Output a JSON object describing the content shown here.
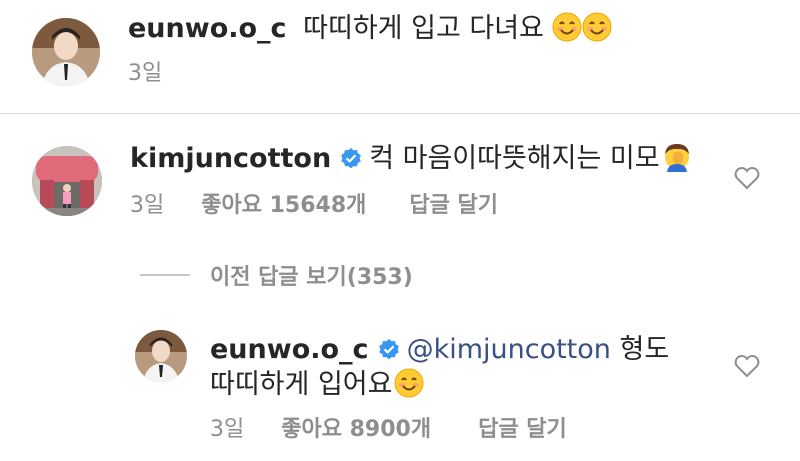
{
  "caption": {
    "username": "eunwo.o_c",
    "text": "따띠하게 입고 다녀요",
    "emoji": [
      "smiling-face-icon",
      "smiling-face-icon"
    ],
    "time": "3일"
  },
  "comments": [
    {
      "username": "kimjuncotton",
      "verified": true,
      "text": "컥 마음이따뜻해지는 미모",
      "emoji": "face-palm-icon",
      "time": "3일",
      "likes": "좋아요 15648개",
      "reply_label": "답글 달기"
    }
  ],
  "view_replies_label": "이전 답글 보기(353)",
  "reply": {
    "username": "eunwo.o_c",
    "verified": true,
    "mention": "@kimjuncotton",
    "text_line1": " 형도",
    "text_line2": "따띠하게 입어요",
    "emoji": "smiling-face-icon",
    "time": "3일",
    "likes": "좋아요 8900개",
    "reply_label": "답글 달기"
  },
  "colors": {
    "text": "#262626",
    "secondary": "#8e8e8e",
    "mention": "#385185",
    "verified_blue": "#3897f0",
    "divider": "#dbdbdb"
  }
}
